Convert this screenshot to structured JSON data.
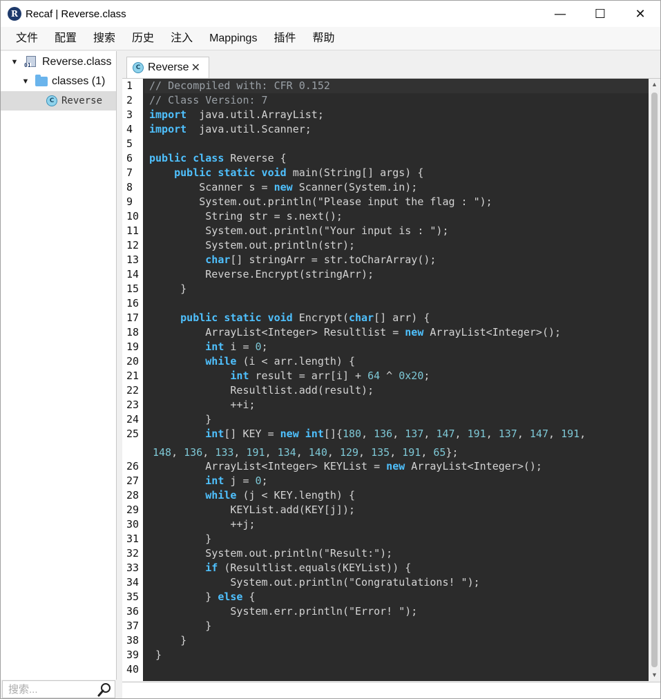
{
  "window": {
    "title": "Recaf | Reverse.class",
    "app_icon_letter": "R",
    "controls": {
      "minimize": "—",
      "maximize": "☐",
      "close": "✕"
    }
  },
  "menu": [
    "文件",
    "配置",
    "搜索",
    "历史",
    "注入",
    "Mappings",
    "插件",
    "帮助"
  ],
  "tree": {
    "root_label": "Reverse.class",
    "root_icon_tag": "01",
    "folder_label": "classes (1)",
    "class_label": "Reverse",
    "class_icon_letter": "C"
  },
  "search": {
    "placeholder": "搜索..."
  },
  "tab": {
    "label": "Reverse",
    "close": "✕",
    "icon_letter": "C"
  },
  "line_numbers": [
    "1",
    "2",
    "3",
    "4",
    "5",
    "6",
    "7",
    "8",
    "9",
    "10",
    "11",
    "12",
    "13",
    "14",
    "15",
    "16",
    "17",
    "18",
    "19",
    "20",
    "21",
    "22",
    "23",
    "24",
    "25",
    "",
    "26",
    "27",
    "28",
    "29",
    "30",
    "31",
    "32",
    "33",
    "34",
    "35",
    "36",
    "37",
    "38",
    "39",
    "40"
  ],
  "code": [
    [
      [
        "cm",
        "// Decompiled with: CFR 0.152"
      ]
    ],
    [
      [
        "cm",
        "// Class Version: 7"
      ]
    ],
    [
      [
        "kw",
        "import"
      ],
      [
        "",
        "  java.util.ArrayList;"
      ]
    ],
    [
      [
        "kw",
        "import"
      ],
      [
        "",
        "  java.util.Scanner;"
      ]
    ],
    [],
    [
      [
        "kw",
        "public class"
      ],
      [
        "",
        " Reverse {"
      ]
    ],
    [
      [
        "",
        "    "
      ],
      [
        "kw",
        "public static void"
      ],
      [
        "",
        " main(String[] args) {"
      ]
    ],
    [
      [
        "",
        "        Scanner s = "
      ],
      [
        "kw",
        "new"
      ],
      [
        "",
        " Scanner(System.in);"
      ]
    ],
    [
      [
        "",
        "        System.out.println(\"Please input the flag : \");"
      ]
    ],
    [
      [
        "",
        "         String str = s.next();"
      ]
    ],
    [
      [
        "",
        "         System.out.println(\"Your input is : \");"
      ]
    ],
    [
      [
        "",
        "         System.out.println(str);"
      ]
    ],
    [
      [
        "",
        "         "
      ],
      [
        "kw",
        "char"
      ],
      [
        "",
        "[] stringArr = str.toCharArray();"
      ]
    ],
    [
      [
        "",
        "         Reverse.Encrypt(stringArr);"
      ]
    ],
    [
      [
        "",
        "     }"
      ]
    ],
    [],
    [
      [
        "",
        "     "
      ],
      [
        "kw",
        "public static void"
      ],
      [
        "",
        " Encrypt("
      ],
      [
        "kw",
        "char"
      ],
      [
        "",
        "[] arr) {"
      ]
    ],
    [
      [
        "",
        "         ArrayList<Integer> Resultlist = "
      ],
      [
        "kw",
        "new"
      ],
      [
        "",
        " ArrayList<Integer>();"
      ]
    ],
    [
      [
        "",
        "         "
      ],
      [
        "kw",
        "int"
      ],
      [
        "",
        " i = "
      ],
      [
        "num",
        "0"
      ],
      [
        "",
        ";"
      ]
    ],
    [
      [
        "",
        "         "
      ],
      [
        "kw",
        "while"
      ],
      [
        "",
        " (i < arr.length) {"
      ]
    ],
    [
      [
        "",
        "             "
      ],
      [
        "kw",
        "int"
      ],
      [
        "",
        " result = arr[i] + "
      ],
      [
        "num",
        "64"
      ],
      [
        "",
        " ^ "
      ],
      [
        "num",
        "0x20"
      ],
      [
        "",
        ";"
      ]
    ],
    [
      [
        "",
        "             Resultlist.add(result);"
      ]
    ],
    [
      [
        "",
        "             ++i;"
      ]
    ],
    [
      [
        "",
        "         }"
      ]
    ],
    [
      [
        "",
        "         "
      ],
      [
        "kw",
        "int"
      ],
      [
        "",
        "[] KEY = "
      ],
      [
        "kw",
        "new"
      ],
      [
        "",
        " "
      ],
      [
        "kw",
        "int"
      ],
      [
        "",
        "[]{"
      ],
      [
        "num",
        "180"
      ],
      [
        "",
        ", "
      ],
      [
        "num",
        "136"
      ],
      [
        "",
        ", "
      ],
      [
        "num",
        "137"
      ],
      [
        "",
        ", "
      ],
      [
        "num",
        "147"
      ],
      [
        "",
        ", "
      ],
      [
        "num",
        "191"
      ],
      [
        "",
        ", "
      ],
      [
        "num",
        "137"
      ],
      [
        "",
        ", "
      ],
      [
        "num",
        "147"
      ],
      [
        "",
        ", "
      ],
      [
        "num",
        "191"
      ],
      [
        "",
        ","
      ]
    ],
    [
      [
        "num",
        "148"
      ],
      [
        "",
        ", "
      ],
      [
        "num",
        "136"
      ],
      [
        "",
        ", "
      ],
      [
        "num",
        "133"
      ],
      [
        "",
        ", "
      ],
      [
        "num",
        "191"
      ],
      [
        "",
        ", "
      ],
      [
        "num",
        "134"
      ],
      [
        "",
        ", "
      ],
      [
        "num",
        "140"
      ],
      [
        "",
        ", "
      ],
      [
        "num",
        "129"
      ],
      [
        "",
        ", "
      ],
      [
        "num",
        "135"
      ],
      [
        "",
        ", "
      ],
      [
        "num",
        "191"
      ],
      [
        "",
        ", "
      ],
      [
        "num",
        "65"
      ],
      [
        "",
        "};"
      ]
    ],
    [
      [
        "",
        "         ArrayList<Integer> KEYList = "
      ],
      [
        "kw",
        "new"
      ],
      [
        "",
        " ArrayList<Integer>();"
      ]
    ],
    [
      [
        "",
        "         "
      ],
      [
        "kw",
        "int"
      ],
      [
        "",
        " j = "
      ],
      [
        "num",
        "0"
      ],
      [
        "",
        ";"
      ]
    ],
    [
      [
        "",
        "         "
      ],
      [
        "kw",
        "while"
      ],
      [
        "",
        " (j < KEY.length) {"
      ]
    ],
    [
      [
        "",
        "             KEYList.add(KEY[j]);"
      ]
    ],
    [
      [
        "",
        "             ++j;"
      ]
    ],
    [
      [
        "",
        "         }"
      ]
    ],
    [
      [
        "",
        "         System.out.println(\"Result:\");"
      ]
    ],
    [
      [
        "",
        "         "
      ],
      [
        "kw",
        "if"
      ],
      [
        "",
        " (Resultlist.equals(KEYList)) {"
      ]
    ],
    [
      [
        "",
        "             System.out.println(\"Congratulations! \");"
      ]
    ],
    [
      [
        "",
        "         } "
      ],
      [
        "kw",
        "else"
      ],
      [
        "",
        " {"
      ]
    ],
    [
      [
        "",
        "             System.err.println(\"Error! \");"
      ]
    ],
    [
      [
        "",
        "         }"
      ]
    ],
    [
      [
        "",
        "     }"
      ]
    ],
    [
      [
        "",
        " }"
      ]
    ],
    []
  ]
}
